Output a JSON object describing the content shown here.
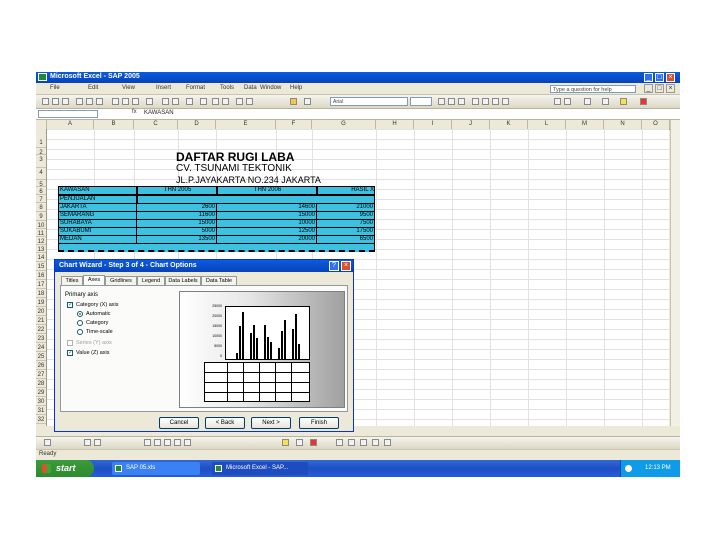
{
  "window": {
    "title": "Microsoft Excel - SAP 2005"
  },
  "menu": {
    "items": [
      "File",
      "Edit",
      "View",
      "Insert",
      "Format",
      "Tools",
      "Data",
      "Window",
      "Help"
    ],
    "help_placeholder": "Type a question for help"
  },
  "toolbar": {
    "font_name": "Arial",
    "zoom": "100%"
  },
  "formula_bar": {
    "fx": "fx",
    "value": "KAWASAN"
  },
  "columns": [
    "A",
    "B",
    "C",
    "D",
    "E",
    "F",
    "G",
    "H",
    "I",
    "J",
    "K",
    "L",
    "M",
    "N",
    "O"
  ],
  "rows": [
    "1",
    "2",
    "3",
    "4",
    "5",
    "6",
    "7",
    "8",
    "9",
    "10",
    "11",
    "12",
    "13",
    "14",
    "15",
    "16",
    "17",
    "18",
    "19",
    "20",
    "21",
    "22",
    "23",
    "24",
    "25",
    "26",
    "27",
    "28",
    "29",
    "30",
    "31",
    "32"
  ],
  "sheet": {
    "title": "DAFTAR RUGI LABA",
    "company": "CV. TSUNAMI TEKTONIK",
    "address": "JL.P.JAYAKARTA NO.234 JAKARTA",
    "table": {
      "headers": [
        "KAWASAN",
        "THN 2005",
        "THN 2006",
        "HASIL X"
      ],
      "subheader": "PENJUALAN",
      "rows": [
        {
          "name": "JAKARTA",
          "v1": "2600",
          "v2": "14600",
          "v3": "21000"
        },
        {
          "name": "SEMARANG",
          "v1": "11600",
          "v2": "15000",
          "v3": "9500"
        },
        {
          "name": "SURABAYA",
          "v1": "15000",
          "v2": "10000",
          "v3": "7500"
        },
        {
          "name": "SUKABUMI",
          "v1": "5000",
          "v2": "12500",
          "v3": "17500"
        },
        {
          "name": "MEDAN",
          "v1": "13500",
          "v2": "20000",
          "v3": "6500"
        }
      ]
    }
  },
  "dialog": {
    "title": "Chart Wizard - Step 3 of 4 - Chart Options",
    "tabs": [
      "Titles",
      "Axes",
      "Gridlines",
      "Legend",
      "Data Labels",
      "Data Table"
    ],
    "group_label": "Primary axis",
    "options": {
      "category_x": "Category (X) axis",
      "automatic": "Automatic",
      "category": "Category",
      "time_scale": "Time-scale",
      "series_y": "Series (Y) axis",
      "value_z": "Value (Z) axis"
    },
    "preview_ticks": [
      "25000",
      "20000",
      "15000",
      "10000",
      "5000",
      "0"
    ],
    "buttons": [
      "Cancel",
      "< Back",
      "Next >",
      "Finish"
    ]
  },
  "status": {
    "ready": "Ready"
  },
  "taskbar": {
    "start": "start",
    "tasks": [
      "SAP 05.xls",
      "Microsoft Excel - SAP..."
    ],
    "clock": "12:13 PM"
  }
}
